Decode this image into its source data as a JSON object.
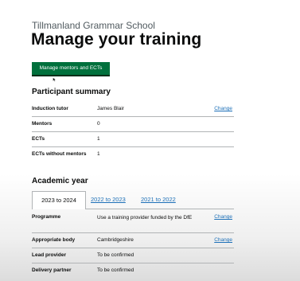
{
  "header": {
    "school_name": "Tillmanland Grammar School",
    "page_title": "Manage your training",
    "manage_button": "Manage mentors and ECTs"
  },
  "participant_summary": {
    "heading": "Participant summary",
    "rows": [
      {
        "label": "Induction tutor",
        "value": "James Blair",
        "action": "Change"
      },
      {
        "label": "Mentors",
        "value": "0"
      },
      {
        "label": "ECTs",
        "value": "1"
      },
      {
        "label": "ECTs without mentors",
        "value": "1"
      }
    ]
  },
  "academic_year": {
    "heading": "Academic year",
    "tabs": [
      "2023 to 2024",
      "2022 to 2023",
      "2021 to 2022"
    ],
    "active_tab": "2023 to 2024",
    "rows": [
      {
        "label": "Programme",
        "value": "Use a training provider funded by the DfE",
        "action": "Change"
      },
      {
        "label": "Appropriate body",
        "value": "Cambridgeshire",
        "action": "Change"
      },
      {
        "label": "Lead provider",
        "value": "To be confirmed"
      },
      {
        "label": "Delivery partner",
        "value": "To be confirmed"
      }
    ]
  },
  "colors": {
    "button_green": "#00703c",
    "link_blue": "#1d70b8",
    "text": "#0b0c0c",
    "border": "#b1b4b6"
  },
  "icons": [
    "mouse-pointer-icon"
  ]
}
